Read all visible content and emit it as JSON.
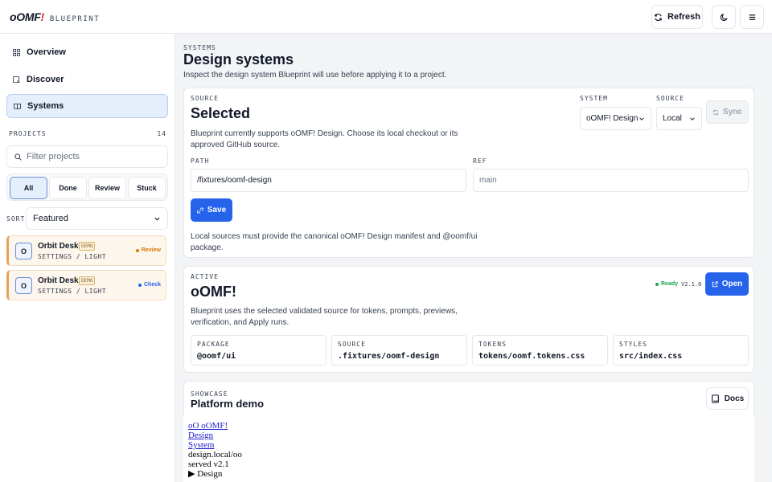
{
  "header": {
    "logo_main": "oOMF",
    "logo_bang": "!",
    "logo_sub": "BLUEPRINT",
    "refresh_label": "Refresh"
  },
  "sidebar": {
    "nav": [
      {
        "label": "Overview",
        "icon": "grid-icon"
      },
      {
        "label": "Discover",
        "icon": "discover-icon"
      },
      {
        "label": "Systems",
        "icon": "book-icon",
        "active": true
      }
    ],
    "projects_label": "PROJECTS",
    "projects_count": "14",
    "filter_placeholder": "Filter projects",
    "filters": [
      "All",
      "Done",
      "Review",
      "Stuck"
    ],
    "active_filter": "All",
    "sort_label": "SORT",
    "sort_value": "Featured",
    "projects": [
      {
        "avatar": "O",
        "name": "Orbit Desk",
        "badge": "DEMO",
        "sub": "SETTINGS / LIGHT",
        "status": "Review",
        "status_color": "#d97706"
      },
      {
        "avatar": "O",
        "name": "Orbit Desk",
        "badge": "DEMO",
        "sub": "SETTINGS / LIGHT",
        "status": "Check",
        "status_color": "#2563eb"
      }
    ]
  },
  "main": {
    "crumb": "SYSTEMS",
    "title": "Design systems",
    "description": "Inspect the design system Blueprint will use before applying it to a project."
  },
  "source_card": {
    "caption": "SOURCE",
    "title": "Selected",
    "description_1": "Blueprint currently supports oOMF! Design. Choose its local checkout or its",
    "description_2": "approved GitHub source.",
    "system_label": "SYSTEM",
    "system_value": "oOMF! Design",
    "source_label": "SOURCE",
    "source_value": "Local",
    "sync_label": "Sync",
    "path_label": "PATH",
    "path_value": "/fixtures/oomf-design",
    "ref_label": "REF",
    "ref_placeholder": "main",
    "save_label": "Save",
    "note_1": "Local sources must provide the canonical oOMF! Design manifest and @oomf/ui",
    "note_2": "package."
  },
  "active_card": {
    "caption": "ACTIVE",
    "title": "oOMF!",
    "status": "Ready",
    "version": "V2.1.0",
    "open_label": "Open",
    "description_1": "Blueprint uses the selected validated source for tokens, prompts, previews,",
    "description_2": "verification, and Apply runs.",
    "meta": [
      {
        "k": "PACKAGE",
        "v": "@oomf/ui"
      },
      {
        "k": "SOURCE",
        "v": ".fixtures/oomf-design"
      },
      {
        "k": "TOKENS",
        "v": "tokens/oomf.tokens.css"
      },
      {
        "k": "STYLES",
        "v": "src/index.css"
      }
    ]
  },
  "showcase": {
    "caption": "SHOWCASE",
    "title": "Platform demo",
    "docs_label": "Docs",
    "raw_links": [
      "oO oOMF!",
      "Design",
      "System"
    ],
    "raw_text_1": "design.local/oo",
    "raw_text_2": "served v2.1",
    "raw_summary": "Design"
  },
  "colors": {
    "accent": "#2563eb",
    "ready": "#16a34a",
    "review": "#d97706",
    "brand_bang": "#dc2626"
  }
}
